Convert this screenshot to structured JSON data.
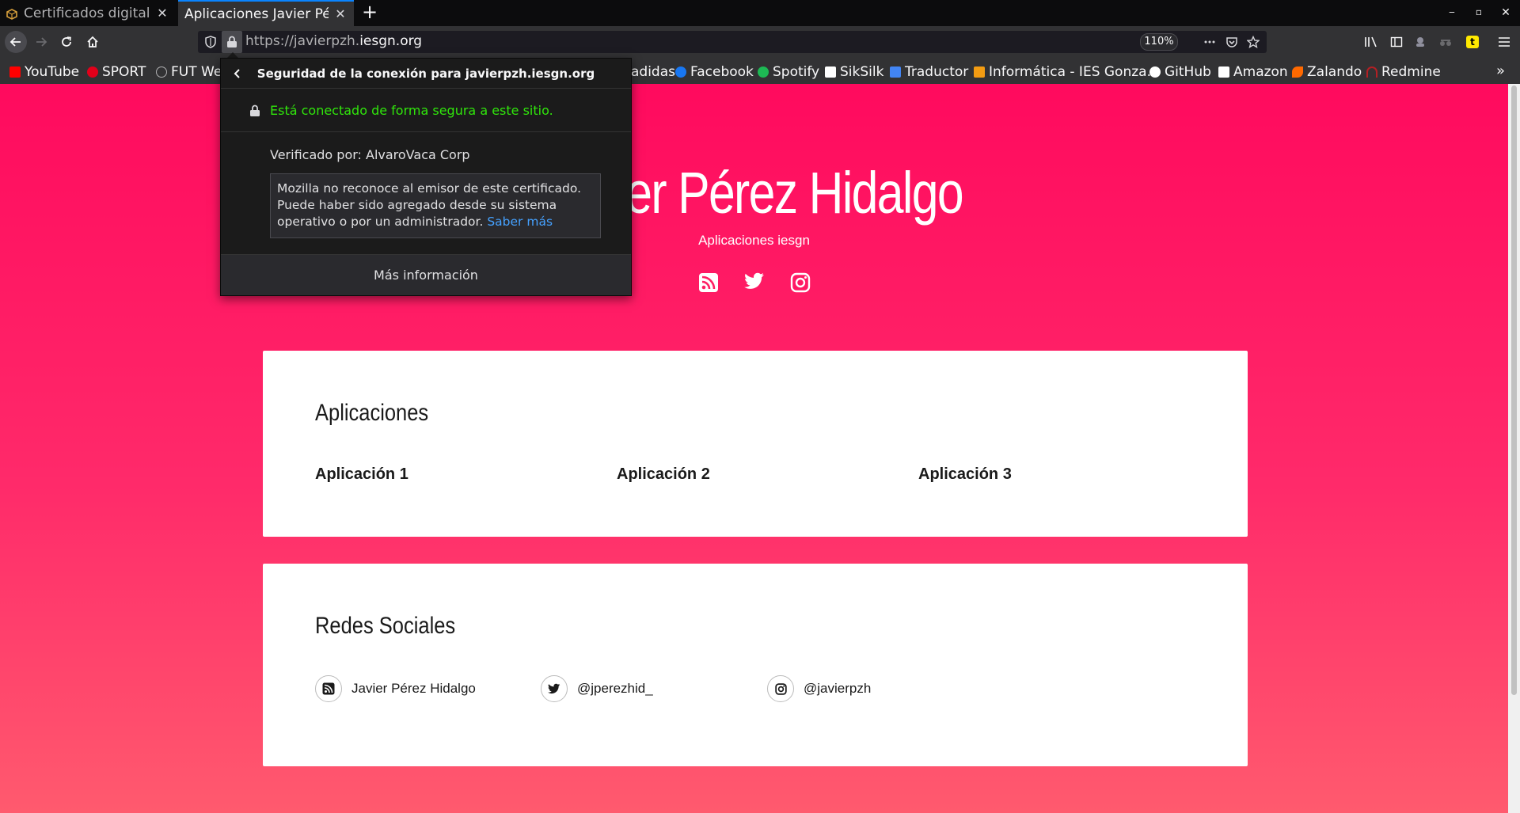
{
  "tabs": [
    {
      "title": "Certificados digitales.",
      "active": false
    },
    {
      "title": "Aplicaciones Javier Pérez",
      "active": true
    }
  ],
  "navbar": {
    "url_prefix": "https://javierpzh.",
    "url_domain": "iesgn.org",
    "zoom": "110%"
  },
  "bookmarks": [
    {
      "label": "YouTube",
      "icon": "youtube-icon",
      "color": "#ff0000"
    },
    {
      "label": "SPORT",
      "icon": "sport-icon",
      "color": "#e2001a"
    },
    {
      "label": "FUT We",
      "icon": "globe-icon",
      "color": "#b1b1b3"
    },
    {
      "label": "adidas",
      "icon": "adidas-icon",
      "color": "#ffffff"
    },
    {
      "label": "Facebook",
      "icon": "facebook-icon",
      "color": "#1877f2"
    },
    {
      "label": "Spotify",
      "icon": "spotify-icon",
      "color": "#1db954"
    },
    {
      "label": "SikSilk",
      "icon": "siksilk-icon",
      "color": "#ffffff"
    },
    {
      "label": "Traductor",
      "icon": "translate-icon",
      "color": "#4285f4"
    },
    {
      "label": "Informática - IES Gonza...",
      "icon": "ies-icon",
      "color": "#f39c12"
    },
    {
      "label": "GitHub",
      "icon": "github-icon",
      "color": "#ffffff"
    },
    {
      "label": "Amazon",
      "icon": "amazon-icon",
      "color": "#ffffff"
    },
    {
      "label": "Zalando",
      "icon": "zalando-icon",
      "color": "#ff6900"
    },
    {
      "label": "Redmine",
      "icon": "redmine-icon",
      "color": "#b32024"
    }
  ],
  "popup": {
    "title": "Seguridad de la conexión para javierpzh.iesgn.org",
    "secure_text": "Está conectado de forma segura a este sitio.",
    "verified_by": "Verificado por: AlvaroVaca Corp",
    "note_text": "Mozilla no reconoce al emisor de este certificado. Puede haber sido agregado desde su sistema operativo o por un administrador.",
    "note_link": "Saber más",
    "more_info": "Más información"
  },
  "site": {
    "title": "Javier Pérez Hidalgo",
    "subtitle": "Aplicaciones iesgn",
    "apps_heading": "Aplicaciones",
    "apps": [
      "Aplicación 1",
      "Aplicación 2",
      "Aplicación 3"
    ],
    "social_heading": "Redes Sociales",
    "social": [
      {
        "label": "Javier Pérez Hidalgo",
        "icon": "rss-icon"
      },
      {
        "label": "@jperezhid_",
        "icon": "twitter-icon"
      },
      {
        "label": "@javierpzh",
        "icon": "instagram-icon"
      }
    ]
  },
  "colors": {
    "page_gradient_top": "#ff0a5e",
    "page_gradient_bottom": "#ff5a6e",
    "secure_green": "#30e60b",
    "link_blue": "#45a1ff"
  }
}
